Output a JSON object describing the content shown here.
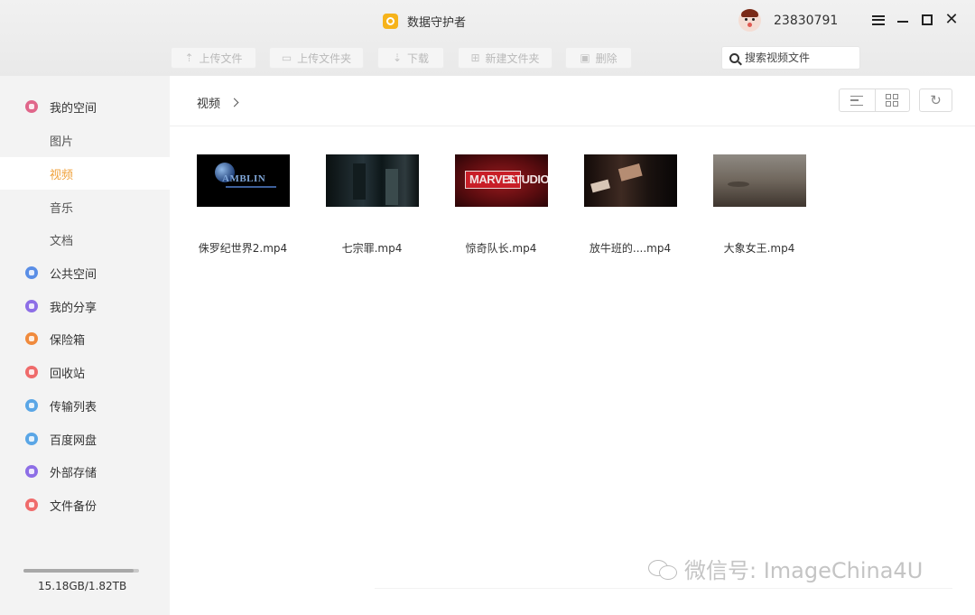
{
  "app": {
    "title": "数据守护者"
  },
  "user": {
    "id": "23830791"
  },
  "toolbar": {
    "upload_file": "上传文件",
    "upload_folder": "上传文件夹",
    "download": "下载",
    "new_folder": "新建文件夹",
    "delete": "删除"
  },
  "search": {
    "placeholder": "搜索视频文件",
    "value": ""
  },
  "sidebar": {
    "my_space": "我的空间",
    "sub_items": [
      "图片",
      "视频",
      "音乐",
      "文档"
    ],
    "active_sub": "视频",
    "items": [
      "公共空间",
      "我的分享",
      "保险箱",
      "回收站",
      "传输列表",
      "百度网盘",
      "外部存储",
      "文件备份"
    ],
    "icon_colors": [
      "#5a8ee6",
      "#8d6ee6",
      "#f08a3c",
      "#ef6b6b",
      "#5aa6e6",
      "#5aa6e6",
      "#8d6ee6",
      "#ef6b6b"
    ],
    "storage_text": "15.18GB/1.82TB",
    "storage_fraction": 0.95
  },
  "breadcrumb": {
    "current": "视频"
  },
  "files": [
    {
      "name": "侏罗纪世界2.mp4",
      "thumb_text": "AMBLIN"
    },
    {
      "name": "七宗罪.mp4"
    },
    {
      "name": "惊奇队长.mp4",
      "thumb_text_1": "MARVEL",
      "thumb_text_2": "STUDIOS"
    },
    {
      "name": "放牛班的....mp4"
    },
    {
      "name": "大象女王.mp4"
    }
  ],
  "watermark": {
    "text": "微信号: ImageChina4U"
  }
}
